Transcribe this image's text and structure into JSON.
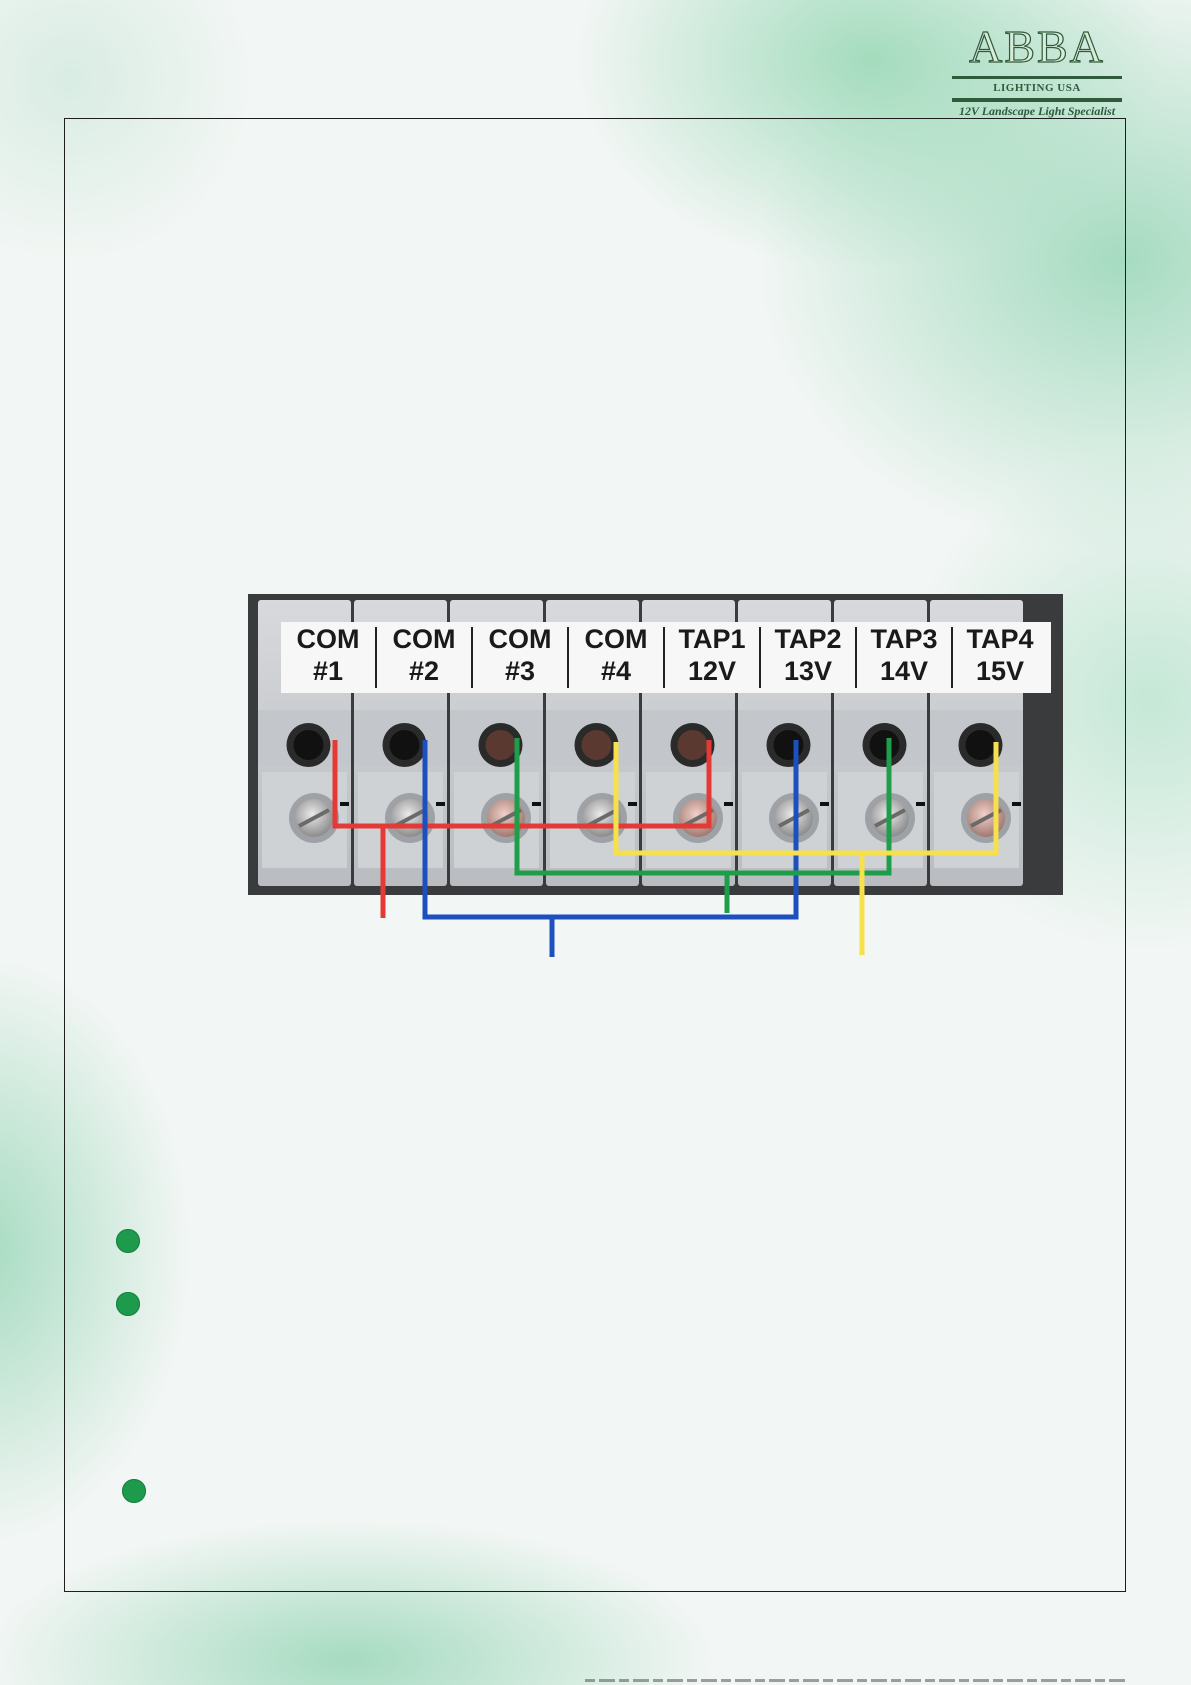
{
  "brand": {
    "name": "ABBA",
    "subtitle": "LIGHTING USA",
    "tagline": "12V Landscape Light Specialist",
    "color": "#2f5a3c"
  },
  "terminal_block": {
    "terminals": [
      {
        "line1": "COM",
        "line2": "#1"
      },
      {
        "line1": "COM",
        "line2": "#2"
      },
      {
        "line1": "COM",
        "line2": "#3"
      },
      {
        "line1": "COM",
        "line2": "#4"
      },
      {
        "line1": "TAP1",
        "line2": "12V"
      },
      {
        "line1": "TAP2",
        "line2": "13V"
      },
      {
        "line1": "TAP3",
        "line2": "14V"
      },
      {
        "line1": "TAP4",
        "line2": "15V"
      }
    ],
    "wire_colors": {
      "red": "#e53935",
      "blue": "#1e4fbf",
      "green": "#1f9e4a",
      "yellow": "#f6e04c"
    }
  },
  "bullets": {
    "color": "#1e9a4c",
    "count": 3
  }
}
